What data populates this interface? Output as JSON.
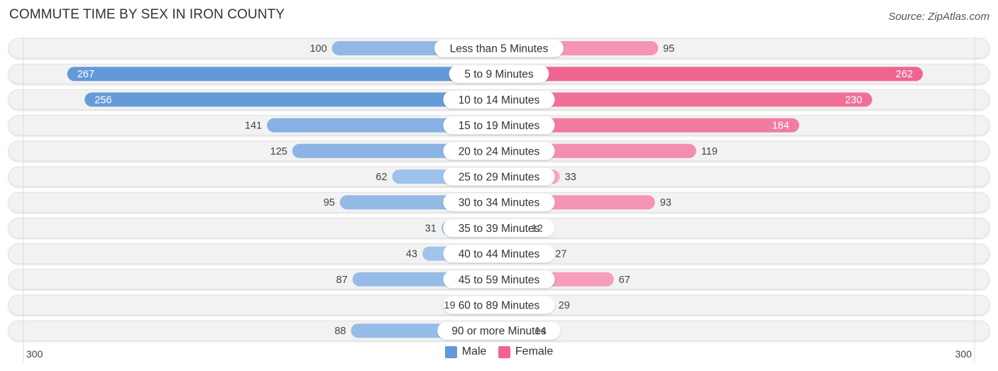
{
  "header": {
    "title": "COMMUTE TIME BY SEX IN IRON COUNTY",
    "source": "Source: ZipAtlas.com"
  },
  "colors": {
    "male": "#6399d8",
    "male_light": "#a8c8ec",
    "female": "#f0648f",
    "female_light": "#f7a9c2",
    "row_bg": "#f2f2f2"
  },
  "chart_data": {
    "type": "bar",
    "orientation": "horizontal-diverging",
    "title": "COMMUTE TIME BY SEX IN IRON COUNTY",
    "categories": [
      "Less than 5 Minutes",
      "5 to 9 Minutes",
      "10 to 14 Minutes",
      "15 to 19 Minutes",
      "20 to 24 Minutes",
      "25 to 29 Minutes",
      "30 to 34 Minutes",
      "35 to 39 Minutes",
      "40 to 44 Minutes",
      "45 to 59 Minutes",
      "60 to 89 Minutes",
      "90 or more Minutes"
    ],
    "series": [
      {
        "name": "Male",
        "side": "left",
        "values": [
          100,
          267,
          256,
          141,
          125,
          62,
          95,
          31,
          43,
          87,
          19,
          88
        ]
      },
      {
        "name": "Female",
        "side": "right",
        "values": [
          95,
          262,
          230,
          184,
          119,
          33,
          93,
          12,
          27,
          67,
          29,
          14
        ]
      }
    ],
    "xlim": [
      -300,
      300
    ],
    "axis_tick_labels": {
      "left": "300",
      "right": "300"
    },
    "legend": {
      "position": "bottom-center",
      "entries": [
        "Male",
        "Female"
      ]
    },
    "grid": false
  }
}
